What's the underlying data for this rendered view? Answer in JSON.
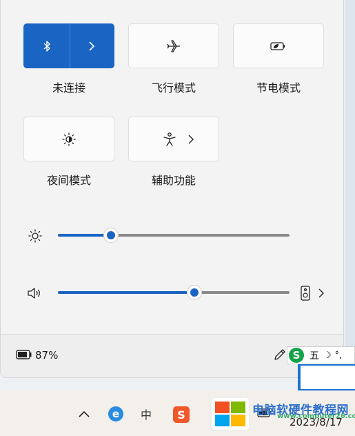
{
  "tiles": [
    {
      "label": "未连接",
      "icon": "bluetooth-icon",
      "active": true
    },
    {
      "label": "飞行模式",
      "icon": "airplane-icon"
    },
    {
      "label": "节电模式",
      "icon": "battery-saver-icon"
    },
    {
      "label": "夜间模式",
      "icon": "night-light-icon"
    },
    {
      "label": "辅助功能",
      "icon": "accessibility-icon"
    }
  ],
  "brightness": {
    "icon": "brightness-icon",
    "level": 0.23
  },
  "volume": {
    "icon": "speaker-icon",
    "level": 0.59,
    "output_icon": "audio-output-icon"
  },
  "footer": {
    "battery_percent": "87%",
    "edit_icon": "pencil-icon"
  },
  "ime": {
    "logo": "S",
    "mode": "五",
    "moon": "☽",
    "punct": "°,"
  },
  "taskbar": {
    "chevron_icon": "chevron-up-icon",
    "edge_icon": "edge-icon",
    "input_lang": "中",
    "sogou_logo": "S"
  },
  "watermark": {
    "text": "电脑软硬件教程网",
    "url": "www.computer26.com",
    "date": "2023/8/17"
  },
  "colors": {
    "accent": "#1a65c4",
    "panel": "#f3f3f3"
  }
}
